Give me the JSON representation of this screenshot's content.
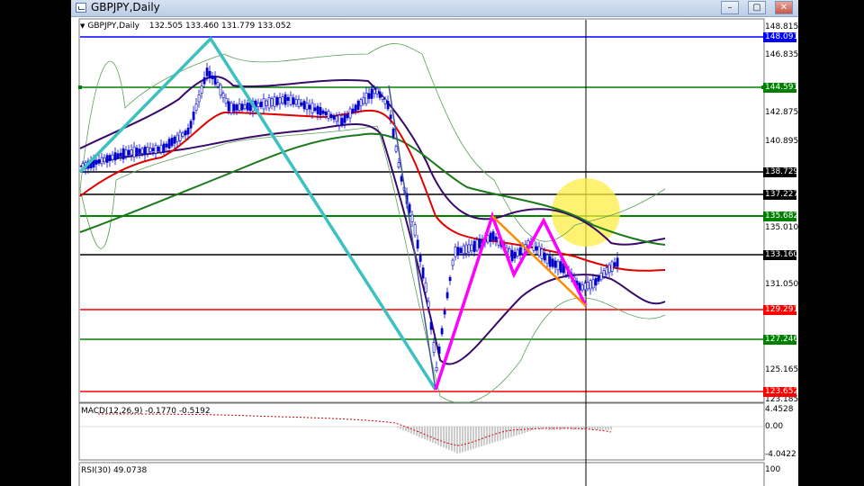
{
  "window": {
    "title": "GBPJPY,Daily",
    "buttons": [
      "–",
      "▢",
      "✕"
    ]
  },
  "chart": {
    "symbol_header": "GBPJPY,Daily",
    "ohlc": "132.505 133.460 131.779 133.052",
    "price_axis": [
      "148.815",
      "146.835",
      "142.875",
      "140.895",
      "135.010",
      "131.050",
      "125.165",
      "123.185"
    ],
    "price_levels": [
      {
        "label": "148.091",
        "color": "#0000ff"
      },
      {
        "label": "144.591",
        "color": "#008000"
      },
      {
        "label": "138.729",
        "color": "#000000"
      },
      {
        "label": "137.227",
        "color": "#000000"
      },
      {
        "label": "135.682",
        "color": "#008000"
      },
      {
        "label": "133.160",
        "color": "#000000"
      },
      {
        "label": "129.291",
        "color": "#ff0000"
      },
      {
        "label": "127.246",
        "color": "#008000"
      },
      {
        "label": "123.652",
        "color": "#ff0000"
      }
    ]
  },
  "macd": {
    "label": "MACD(12,26,9) -0.1770 -0.5192",
    "axis": [
      "4.4528",
      "0.00",
      "-4.0422"
    ]
  },
  "rsi": {
    "label": "RSI(30) 49.0738",
    "axis": [
      "100"
    ]
  },
  "colors": {
    "candle": "#0000cc",
    "ma_red": "#e00000",
    "ma_green": "#1a7a1a",
    "band_purple": "#3a0a6a",
    "band_light": "#5aa05a",
    "zigzag": "#3cc0c0",
    "pattern_magenta": "#ff00ff",
    "pattern_orange": "#ff8c00",
    "highlight": "#ffee44"
  }
}
